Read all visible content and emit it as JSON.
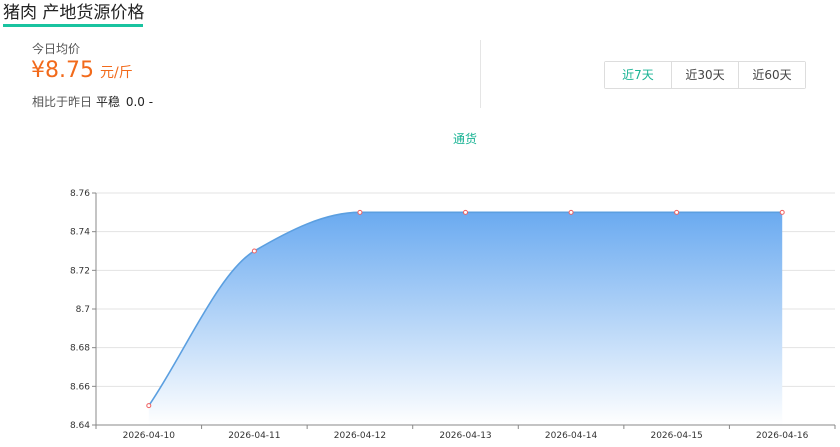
{
  "header": {
    "title": "猪肉 产地货源价格"
  },
  "today": {
    "label": "今日均价",
    "currency": "¥",
    "price": "8.75",
    "unit": "元/斤",
    "compare_label": "相比于昨日",
    "trend": "平稳",
    "delta": "0.0 -"
  },
  "range_tabs": [
    {
      "label": "近7天",
      "active": true
    },
    {
      "label": "近30天",
      "active": false
    },
    {
      "label": "近60天",
      "active": false
    }
  ],
  "colors": {
    "accent": "#19b394",
    "price": "#f26a1b",
    "line": "#5b9fe0",
    "area_top": "#6aaaf0",
    "marker": "#f06060"
  },
  "chart_data": {
    "type": "area",
    "x": [
      "2026-04-10",
      "2026-04-11",
      "2026-04-12",
      "2026-04-13",
      "2026-04-14",
      "2026-04-15",
      "2026-04-16"
    ],
    "series": [
      {
        "name": "通货",
        "values": [
          8.65,
          8.73,
          8.75,
          8.75,
          8.75,
          8.75,
          8.75
        ]
      }
    ],
    "ylim": [
      8.64,
      8.76
    ],
    "yticks": [
      "8.64",
      "8.66",
      "8.68",
      "8.7",
      "8.72",
      "8.74",
      "8.76"
    ],
    "grid": true,
    "legend": "top-center",
    "smooth": true
  }
}
